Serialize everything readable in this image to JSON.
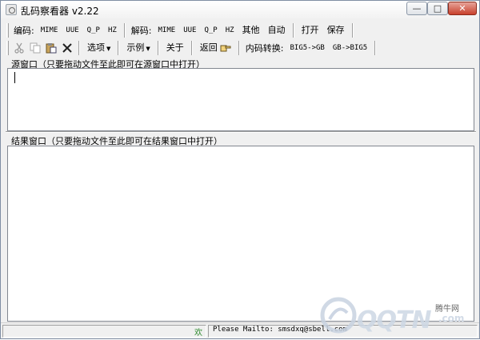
{
  "window": {
    "title": "乱码察看器 v2.22"
  },
  "titlebar_buttons": {
    "minimize": "—",
    "maximize": "□",
    "close": "✕"
  },
  "toolbar1": {
    "encode_label": "编码:",
    "encode_buttons": [
      "MIME",
      "UUE",
      "Q_P",
      "HZ"
    ],
    "decode_label": "解码:",
    "decode_buttons": [
      "MIME",
      "UUE",
      "Q_P",
      "HZ",
      "其他",
      "自动"
    ],
    "open": "打开",
    "save": "保存"
  },
  "toolbar2": {
    "icons": [
      "scissors-icon",
      "copy-icon",
      "paste-icon",
      "delete-icon"
    ],
    "options": "选项",
    "examples": "示例",
    "about": "关于",
    "back": "返回",
    "convert_label": "内码转换:",
    "big5_to_gb": "BIG5->GB",
    "gb_to_big5": "GB->BIG5"
  },
  "source_pane": {
    "label": "源窗口（只要拖动文件至此即可在源窗口中打开）",
    "content": ""
  },
  "result_pane": {
    "label": "结果窗口（只要拖动文件至此即可在结果窗口中打开）",
    "content": ""
  },
  "statusbar": {
    "welcome": "欢",
    "mailto": "Please Mailto: smsdxq@sbell.com"
  },
  "watermark": {
    "text": "QQTN",
    "suffix": ".com",
    "cn": "腾牛网"
  },
  "colors": {
    "accent_close": "#c8402c",
    "welcome_green": "#2e8b2e"
  }
}
